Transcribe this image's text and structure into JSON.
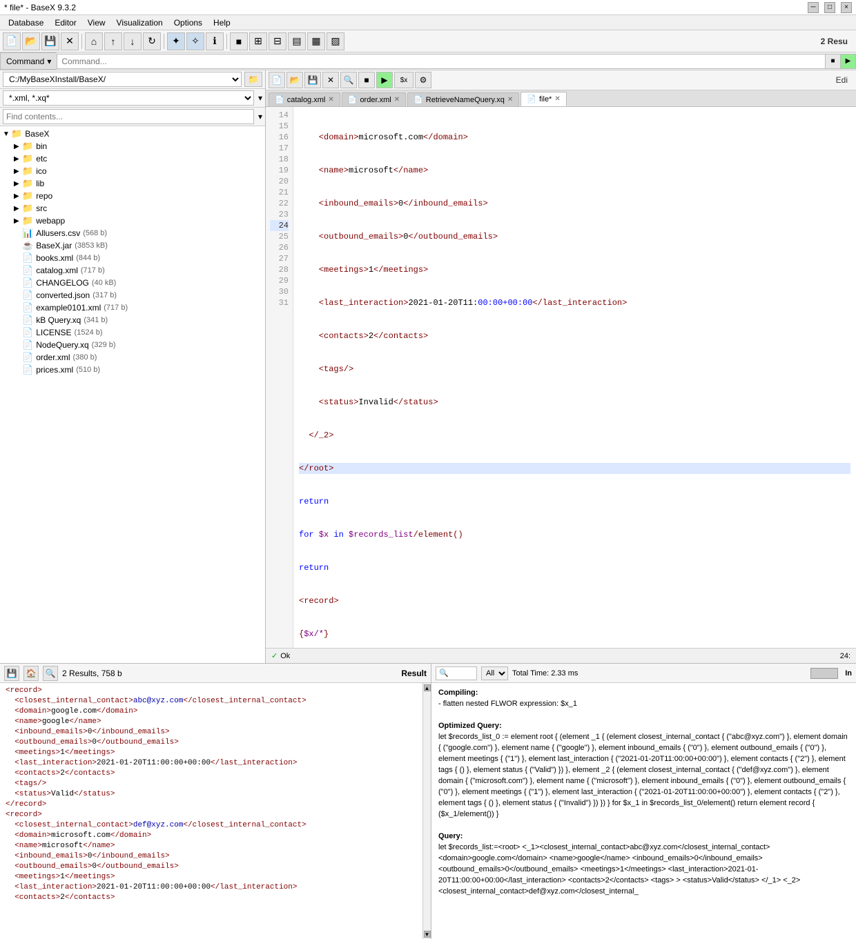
{
  "titleBar": {
    "title": "* file* - BaseX 9.3.2",
    "minimizeLabel": "─",
    "maximizeLabel": "□",
    "closeLabel": "×"
  },
  "menuBar": {
    "items": [
      "Database",
      "Editor",
      "View",
      "Visualization",
      "Options",
      "Help"
    ]
  },
  "commandBar": {
    "label": "Command",
    "placeholder": "Command...",
    "stopLabel": "■",
    "runLabel": "▶"
  },
  "leftPanel": {
    "pathValue": "C:/MyBaseXInstall/BaseX/",
    "filterValue": "*.xml, *.xq*",
    "searchPlaceholder": "Find contents...",
    "folderBtn": "📁",
    "tree": [
      {
        "level": 0,
        "type": "folder",
        "name": "BaseX",
        "expanded": true
      },
      {
        "level": 1,
        "type": "folder",
        "name": "bin",
        "expanded": true
      },
      {
        "level": 1,
        "type": "folder",
        "name": "etc",
        "expanded": false
      },
      {
        "level": 1,
        "type": "folder",
        "name": "ico",
        "expanded": false
      },
      {
        "level": 1,
        "type": "folder",
        "name": "lib",
        "expanded": false
      },
      {
        "level": 1,
        "type": "folder",
        "name": "repo",
        "expanded": false
      },
      {
        "level": 1,
        "type": "folder",
        "name": "src",
        "expanded": false
      },
      {
        "level": 1,
        "type": "folder",
        "name": "webapp",
        "expanded": false
      },
      {
        "level": 1,
        "type": "file",
        "name": "Allusers.csv",
        "size": "(568 b)"
      },
      {
        "level": 1,
        "type": "file",
        "name": "BaseX.jar",
        "size": "(3853 kB)"
      },
      {
        "level": 1,
        "type": "file",
        "name": "books.xml",
        "size": "(844 b)"
      },
      {
        "level": 1,
        "type": "file",
        "name": "catalog.xml",
        "size": "(717 b)"
      },
      {
        "level": 1,
        "type": "file",
        "name": "CHANGELOG",
        "size": "(40 kB)"
      },
      {
        "level": 1,
        "type": "file",
        "name": "converted.json",
        "size": "(317 b)"
      },
      {
        "level": 1,
        "type": "file",
        "name": "example0101.xml",
        "size": "(717 b)"
      },
      {
        "level": 1,
        "type": "file",
        "name": "kB Query.xq",
        "size": "(341 b)"
      },
      {
        "level": 1,
        "type": "file",
        "name": "LICENSE",
        "size": "(1524 b)"
      },
      {
        "level": 1,
        "type": "file",
        "name": "NodeQuery.xq",
        "size": "(329 b)"
      },
      {
        "level": 1,
        "type": "file",
        "name": "order.xml",
        "size": "(380 b)"
      },
      {
        "level": 1,
        "type": "file",
        "name": "prices.xml",
        "size": "(510 b)"
      }
    ]
  },
  "editor": {
    "toolbar": {
      "newBtn": "📄",
      "openBtn": "📂",
      "saveBtn": "💾",
      "closeBtn": "✕",
      "searchBtn": "🔍",
      "stopBtn": "■",
      "runBtn": "▶",
      "xqBtn": "$x",
      "debugBtn": "⚙",
      "title": "Edi"
    },
    "tabs": [
      {
        "name": "catalog.xml",
        "active": false,
        "modified": false
      },
      {
        "name": "order.xml",
        "active": false,
        "modified": false
      },
      {
        "name": "RetrieveNameQuery.xq",
        "active": false,
        "modified": false
      },
      {
        "name": "file*",
        "active": true,
        "modified": true
      }
    ],
    "lines": [
      {
        "num": 14,
        "content": "    <domain>microsoft.com</domain>",
        "class": ""
      },
      {
        "num": 15,
        "content": "    <name>microsoft</name>",
        "class": ""
      },
      {
        "num": 16,
        "content": "    <inbound_emails>0</inbound_emails>",
        "class": ""
      },
      {
        "num": 17,
        "content": "    <outbound_emails>0</outbound_emails>",
        "class": ""
      },
      {
        "num": 18,
        "content": "    <meetings>1</meetings>",
        "class": ""
      },
      {
        "num": 19,
        "content": "    <last_interaction>2021-01-20T11:00:00+00:00</last_interaction>",
        "class": ""
      },
      {
        "num": 20,
        "content": "    <contacts>2</contacts>",
        "class": ""
      },
      {
        "num": 21,
        "content": "    <tags/>",
        "class": ""
      },
      {
        "num": 22,
        "content": "    <status>Invalid</status>",
        "class": ""
      },
      {
        "num": 23,
        "content": "  </_2>",
        "class": ""
      },
      {
        "num": 24,
        "content": "</root>",
        "class": "line-24"
      },
      {
        "num": 25,
        "content": "return",
        "class": ""
      },
      {
        "num": 26,
        "content": "for $x in $records_list/element()",
        "class": ""
      },
      {
        "num": 27,
        "content": "return",
        "class": ""
      },
      {
        "num": 28,
        "content": "<record>",
        "class": ""
      },
      {
        "num": 29,
        "content": "{$x/*}",
        "class": ""
      },
      {
        "num": 30,
        "content": "</record>",
        "class": ""
      },
      {
        "num": 31,
        "content": "",
        "class": ""
      }
    ]
  },
  "statusBar": {
    "okText": "✓ Ok",
    "position": "24:"
  },
  "resultPanel": {
    "saveBtn": "💾",
    "homeBtn": "🏠",
    "searchBtn": "🔍",
    "count": "2 Results, 758 b",
    "label": "Result",
    "scrollUpLabel": "▲",
    "scrollDownLabel": "▼",
    "content": [
      "<record>",
      "  <closest_internal_contact>abc@xyz.com</closest_internal_contact>",
      "  <domain>google.com</domain>",
      "  <name>google</name>",
      "  <inbound_emails>0</inbound_emails>",
      "  <outbound_emails>0</outbound_emails>",
      "  <meetings>1</meetings>",
      "  <last_interaction>2021-01-20T11:00:00+00:00</last_interaction>",
      "  <contacts>2</contacts>",
      "  <tags/>",
      "  <status>Valid</status>",
      "</record>",
      "<record>",
      "  <closest_internal_contact>def@xyz.com</closest_internal_contact>",
      "  <domain>microsoft.com</domain>",
      "  <name>microsoft</name>",
      "  <inbound_emails>0</inbound_emails>",
      "  <outbound_emails>0</outbound_emails>",
      "  <meetings>1</meetings>",
      "  <last_interaction>2021-01-20T11:00:00+00:00</last_interaction>",
      "  <contacts>2</contacts>"
    ]
  },
  "infoPanel": {
    "searchPlaceholder": "🔍",
    "filterValue": "All",
    "time": "Total Time: 2.33 ms",
    "inLabel": "In",
    "compilingTitle": "Compiling:",
    "compilingText": "- flatten nested FLWOR expression: $x_1",
    "optimizedTitle": "Optimized Query:",
    "optimizedText": "let $records_list_0 := element root { (element _1 { (element closest_internal_contact { (\"abc@xyz.com\") }, element domain { (\"google.com\") }, element name { (\"google\") }, element inbound_emails { (\"0\") }, element outbound_emails { (\"0\") }, element meetings { (\"1\") }, element last_interaction { (\"2021-01-20T11:00:00+00:00\") }, element contacts { (\"2\") }, element tags { () }, element status { (\"Valid\") }) }, element _2 { (element closest_internal_contact { (\"def@xyz.com\") }, element domain { (\"microsoft.com\") }, element name { (\"microsoft\") }, element inbound_emails { (\"0\") }, element outbound_emails { (\"0\") }, element meetings { (\"1\") }, element last_interaction { (\"2021-01-20T11:00:00+00:00\") }, element contacts { (\"2\") }, element tags { () }, element status { (\"Invalid\") }) }) } for $x_1 in $records_list_0/element() return element record { ($x_1/element()) }",
    "queryTitle": "Query:",
    "queryText": "let $records_list:=<root> <_1><closest_internal_contact>abc@xyz.com</closest_internal_contact> <domain>google.com</domain> <name>google</name> <inbound_emails>0</inbound_emails> <outbound_emails>0</outbound_emails> <meetings>1</meetings> <last_interaction>2021-01-20T11:00:00+00:00</last_interaction> <contacts>2</contacts> <tags> > <status>Valid</status> </_1> <_2> <closest_internal_contact>def@xyz.com</closest_internal_"
  }
}
